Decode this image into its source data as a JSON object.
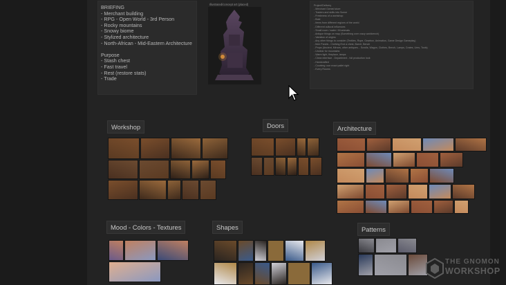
{
  "briefing": {
    "lines": [
      "BRIEFING",
      "- Merchant  building",
      "- RPG - Open World - 3rd Person",
      "- Rocky mountains",
      "- Snowy biome",
      "- Stylized architecture",
      "- North-African - Mid-Eastern Architecture",
      "",
      "Purpose",
      "- Stash chest",
      "- Fast travel",
      "- Rest (restore stats)",
      "- Trade"
    ]
  },
  "hero": {
    "caption": "Illustrated/concept art (placed)",
    "icon": "merchant-building-concept-image"
  },
  "project_notes": {
    "lines": [
      "Project/Delivery",
      "- Merchant Owned store",
      "- Traders and skills into Scene",
      "- Freshness of a workshop",
      "- Bold",
      "- Items from different regions of the world",
      "- Different cultural influences",
      "- Small room / water / fill animals",
      "- Antique things on map (Something over crazy workbench)",
      "- Variation of origins",
      "- Any other things to consider (Textiles, Rope, Gearbox, Animation, Game Design Gameplay)",
      "- Item Panels - Clothing End a chest, Barrel, Bench",
      "- Props (Ancient, Mirrors, other antiques... Scrolls, Wagon, Clothes, Bench, Lamps, Crates, Urns, Tools)",
      "- Unclear for mountains",
      "- Warm light, fireplace, lamps",
      "- Clean interface - Department - full production look",
      "- Handcrafted",
      "- Courtesy, use exact pallet right",
      "- Every Rooms"
    ]
  },
  "sections": {
    "workshop": "Workshop",
    "doors": "Doors",
    "architecture": "Architecture",
    "mood": "Mood - Colors - Textures",
    "shapes": "Shapes",
    "patterns": "Patterns"
  },
  "watermark": {
    "line1": "THE GNOMON",
    "line2": "WORKSHOP"
  },
  "colors": {
    "background": "#1b1b1b",
    "board": "#232323",
    "note": "#2b2b2b",
    "warm": "#8a5a32",
    "sky": "#3f5a8c"
  }
}
